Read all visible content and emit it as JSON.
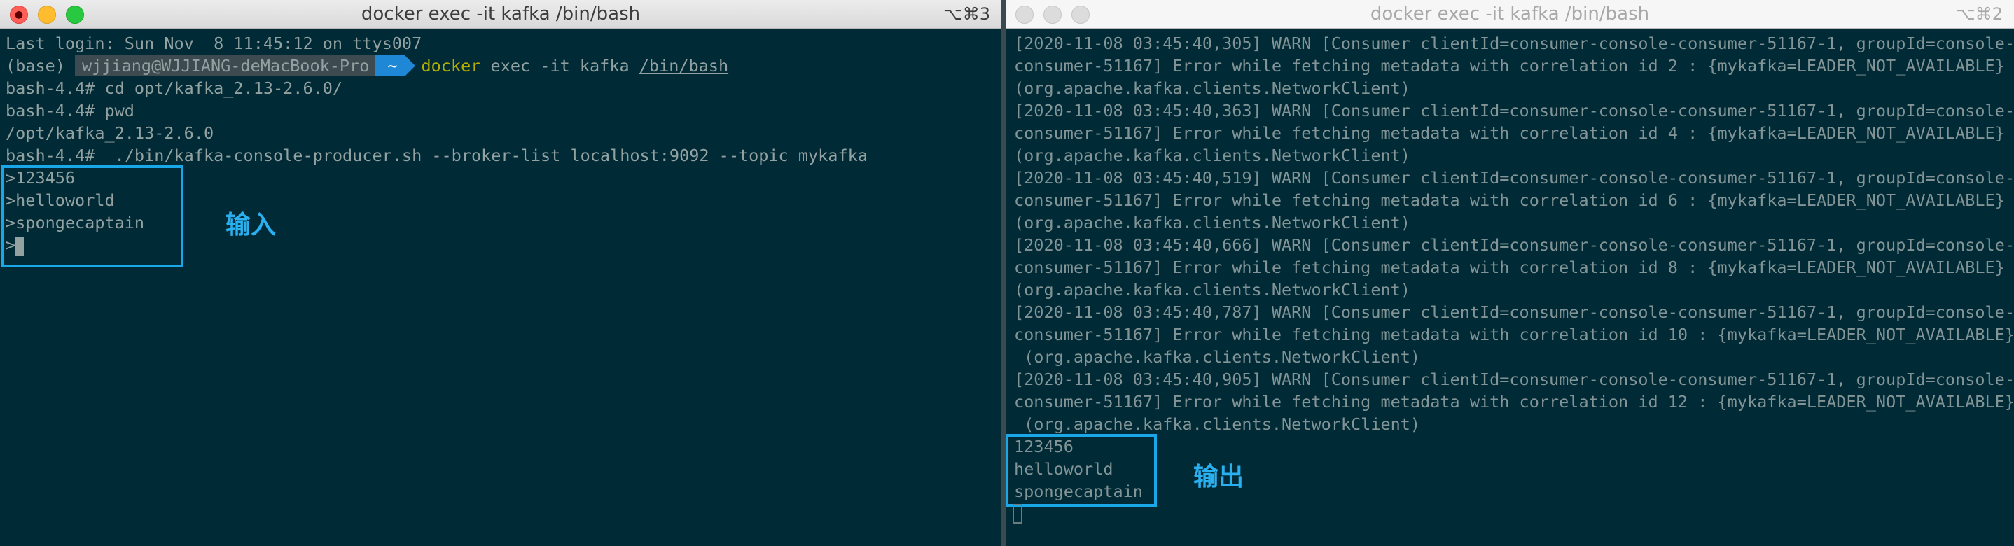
{
  "left": {
    "title": "docker exec -it kafka /bin/bash",
    "shortcut": "⌥⌘3",
    "lines": {
      "login": "Last login: Sun Nov  8 11:45:12 on ttys007",
      "base": "(base)",
      "user_host": "wjjiang@WJJIANG-deMacBook-Pro",
      "tilde": "~",
      "cmd_docker": "docker",
      "cmd_args": " exec -it kafka ",
      "cmd_path": "/bin/bash",
      "cd": "bash-4.4# cd opt/kafka_2.13-2.6.0/",
      "pwd": "bash-4.4# pwd",
      "pwd_out": "/opt/kafka_2.13-2.6.0",
      "producer": "bash-4.4#  ./bin/kafka-console-producer.sh --broker-list localhost:9092 --topic mykafka",
      "in1": ">123456",
      "in2": ">helloworld",
      "in3": ">spongecaptain",
      "in4": ">"
    },
    "annotation": "输入"
  },
  "right": {
    "title": "docker exec -it kafka /bin/bash",
    "shortcut": "⌥⌘2",
    "lines": [
      "[2020-11-08 03:45:40,305] WARN [Consumer clientId=consumer-console-consumer-51167-1, groupId=console-",
      "consumer-51167] Error while fetching metadata with correlation id 2 : {mykafka=LEADER_NOT_AVAILABLE}",
      "(org.apache.kafka.clients.NetworkClient)",
      "[2020-11-08 03:45:40,363] WARN [Consumer clientId=consumer-console-consumer-51167-1, groupId=console-",
      "consumer-51167] Error while fetching metadata with correlation id 4 : {mykafka=LEADER_NOT_AVAILABLE}",
      "(org.apache.kafka.clients.NetworkClient)",
      "[2020-11-08 03:45:40,519] WARN [Consumer clientId=consumer-console-consumer-51167-1, groupId=console-",
      "consumer-51167] Error while fetching metadata with correlation id 6 : {mykafka=LEADER_NOT_AVAILABLE}",
      "(org.apache.kafka.clients.NetworkClient)",
      "[2020-11-08 03:45:40,666] WARN [Consumer clientId=consumer-console-consumer-51167-1, groupId=console-",
      "consumer-51167] Error while fetching metadata with correlation id 8 : {mykafka=LEADER_NOT_AVAILABLE}",
      "(org.apache.kafka.clients.NetworkClient)",
      "[2020-11-08 03:45:40,787] WARN [Consumer clientId=consumer-console-consumer-51167-1, groupId=console-",
      "consumer-51167] Error while fetching metadata with correlation id 10 : {mykafka=LEADER_NOT_AVAILABLE}",
      " (org.apache.kafka.clients.NetworkClient)",
      "[2020-11-08 03:45:40,905] WARN [Consumer clientId=consumer-console-consumer-51167-1, groupId=console-",
      "consumer-51167] Error while fetching metadata with correlation id 12 : {mykafka=LEADER_NOT_AVAILABLE}",
      " (org.apache.kafka.clients.NetworkClient)",
      "123456",
      "helloworld",
      "spongecaptain"
    ],
    "annotation": "输出"
  }
}
